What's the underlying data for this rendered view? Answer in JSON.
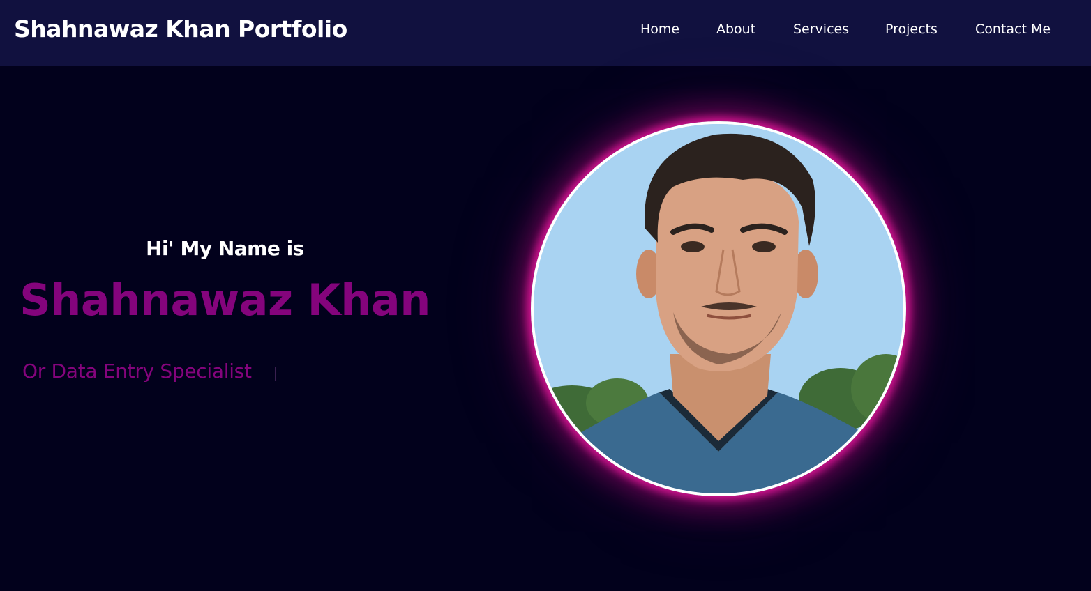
{
  "header": {
    "brand": "Shahnawaz Khan Portfolio",
    "nav": [
      {
        "label": "Home"
      },
      {
        "label": "About"
      },
      {
        "label": "Services"
      },
      {
        "label": "Projects"
      },
      {
        "label": "Contact Me"
      }
    ]
  },
  "hero": {
    "greeting": "Hi' My Name is",
    "name": "Shahnawaz Khan",
    "role": "Or Data Entry Specialist"
  },
  "colors": {
    "nav_background": "#11113f",
    "page_background": "#02011c",
    "accent": "#84047c",
    "glow": "#d1148f"
  }
}
